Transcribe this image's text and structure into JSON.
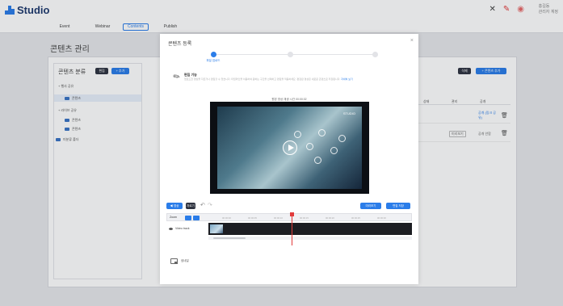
{
  "header": {
    "logo_text": "Studio",
    "user_name": "홍길동",
    "user_role": "관리자 계정"
  },
  "nav": {
    "items": [
      {
        "label": "Event",
        "active": false
      },
      {
        "label": "Webinar",
        "active": false
      },
      {
        "label": "Contents",
        "active": true
      },
      {
        "label": "Publish",
        "active": false
      }
    ]
  },
  "page": {
    "title": "콘텐츠 관리",
    "tree": {
      "title": "콘텐츠 분류",
      "edit_label": "편집",
      "add_label": "+ 추가",
      "items": [
        {
          "label": "+ 행사 공유",
          "kind": "group"
        },
        {
          "label": "콘텐츠",
          "kind": "folder"
        },
        {
          "label": "+ 라이브 공유",
          "kind": "group"
        },
        {
          "label": "콘텐츠",
          "kind": "folder"
        },
        {
          "label": "콘텐츠",
          "kind": "folder"
        },
        {
          "label": "미분류 폴더",
          "kind": "folder"
        }
      ]
    },
    "right": {
      "btn_delete": "삭제",
      "btn_add": "+ 콘텐츠 추가",
      "columns": [
        "상태",
        "관리",
        "공개"
      ],
      "rows": [
        {
          "status": "",
          "badge": "",
          "share": "공개 (링크 공유)"
        },
        {
          "status": "",
          "badge": "미리보기",
          "share": "공개 안함"
        }
      ]
    }
  },
  "modal": {
    "title": "콘텐츠 등록",
    "close": "×",
    "steps": [
      {
        "label": "파일 업로드",
        "active": true
      },
      {
        "label": "",
        "active": false
      },
      {
        "label": "",
        "active": false
      }
    ],
    "info_title": "편집 기능",
    "info_text": "업로드한 영상을 자르거나 편집할 수 있습니다. 타임라인을 이용하여 원하는 구간을 선택하고 편집을 적용하세요. 편집된 영상은 새로운 콘텐츠로 저장됩니다.",
    "info_link": "자세히 보기",
    "video_caption": "원본 영상 재생 시간 00:00:32",
    "video_logo": "STUDIO",
    "toolbar": {
      "btn_left_1": "◀ 영상",
      "btn_left_2": "자르기",
      "btn_right_1": "미리보기",
      "btn_right_2": "편집 저장"
    },
    "timeline": {
      "head_label": "Zoom",
      "ticks": [
        "00:00:00",
        "00:00:05",
        "00:00:10",
        "00:00:15",
        "00:00:20",
        "00:00:25",
        "00:00:30"
      ],
      "track_label": "Video track",
      "playhead_fraction": 0.5
    },
    "option_label": "썸네일"
  },
  "colors": {
    "accent": "#2b7de9",
    "dark": "#2f3441",
    "danger": "#e23b3b"
  }
}
